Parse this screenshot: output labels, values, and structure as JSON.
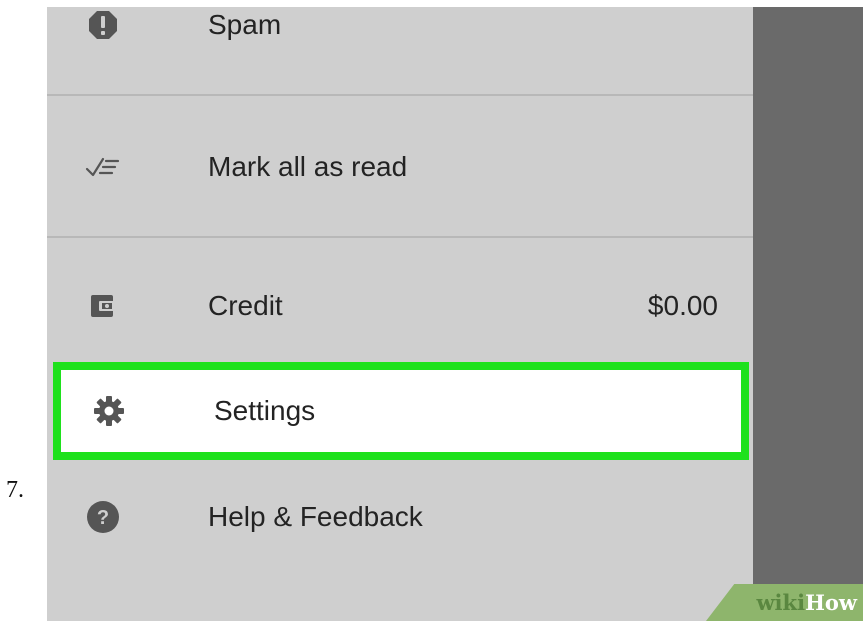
{
  "step_number": "7.",
  "drawer": {
    "items": [
      {
        "label": "Spam",
        "icon": "spam-alert-icon"
      },
      {
        "label": "Mark all as read",
        "icon": "mark-all-read-icon"
      },
      {
        "label": "Credit",
        "value": "$0.00",
        "icon": "wallet-icon"
      },
      {
        "label": "Settings",
        "icon": "gear-icon",
        "highlighted": true
      },
      {
        "label": "Help & Feedback",
        "icon": "help-icon"
      }
    ]
  },
  "colors": {
    "drawer_bg": "#cfcfcf",
    "overlay": "#6a6a6a",
    "highlight_border": "#1ee11c",
    "icon": "#555555",
    "text": "#232323"
  },
  "watermark": {
    "part1": "wiki",
    "part2": "How"
  }
}
